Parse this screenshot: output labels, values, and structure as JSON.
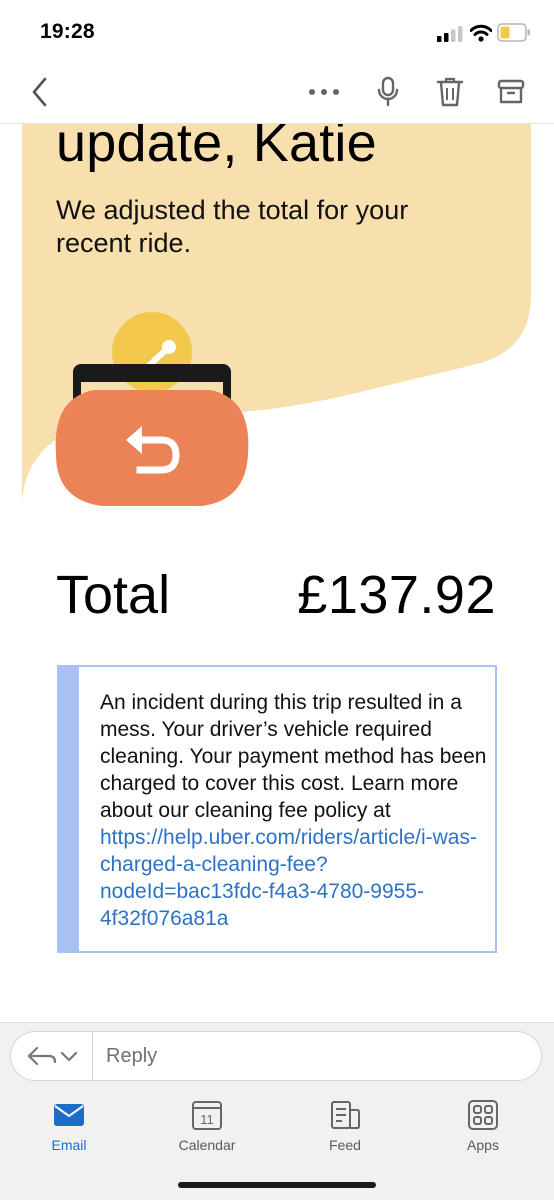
{
  "status_bar": {
    "time": "19:28",
    "icons": [
      "cellular-signal-icon",
      "wifi-icon",
      "battery-low-icon"
    ],
    "battery_color": "#f2c94c"
  },
  "toolbar": {
    "icons": [
      "chevron-left-icon",
      "more-dots-icon",
      "microphone-icon",
      "trash-icon",
      "archive-icon"
    ]
  },
  "email": {
    "hero_title": "update, Katie",
    "hero_text": "We adjusted the total for your recent ride.",
    "hero_bg_color": "#f7e0ae",
    "illustration": "wallet-refund-icon",
    "total_label": "Total",
    "total_amount": "£137.92",
    "notice": {
      "text": "An incident during this trip resulted in a mess. Your driver’s vehicle required cleaning. Your payment method has been charged to cover this cost. Learn more about our cleaning fee policy at ",
      "link": "https://help.uber.com/riders/article/i-was-charged-a-cleaning-fee?nodeId=bac13fdc-f4a3-4780-9955-4f32f076a81a",
      "accent_color": "#a9c1f2",
      "link_color": "#2d72c7"
    }
  },
  "reply": {
    "placeholder": "Reply",
    "icons": [
      "reply-arrow-icon",
      "chevron-down-icon"
    ]
  },
  "tabs": [
    {
      "label": "Email",
      "icon": "email-icon",
      "active": true
    },
    {
      "label": "Calendar",
      "icon": "calendar-icon",
      "badge": "11"
    },
    {
      "label": "Feed",
      "icon": "feed-icon"
    },
    {
      "label": "Apps",
      "icon": "apps-grid-icon"
    }
  ],
  "accent_color": "#1c6cc8"
}
